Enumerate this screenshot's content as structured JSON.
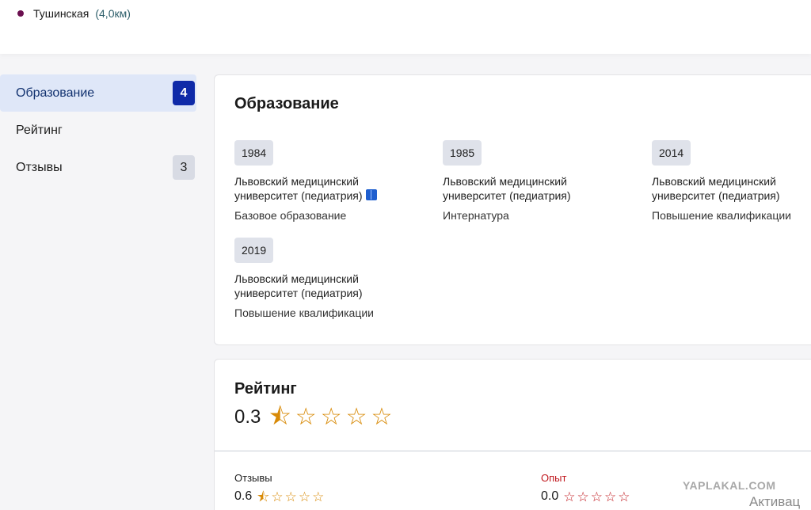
{
  "metro": {
    "station": "Тушинская",
    "distance": "(4,0км)"
  },
  "sidebar": {
    "items": [
      {
        "label": "Образование",
        "badge": "4"
      },
      {
        "label": "Рейтинг",
        "badge": ""
      },
      {
        "label": "Отзывы",
        "badge": "3"
      }
    ]
  },
  "education": {
    "title": "Образование",
    "items": [
      {
        "year": "1984",
        "institution": "Львовский медицинский университет (педиатрия)",
        "type": "Базовое образование"
      },
      {
        "year": "1985",
        "institution": "Львовский медицинский университет (педиатрия)",
        "type": "Интернатура"
      },
      {
        "year": "2014",
        "institution": "Львовский медицинский университет (педиатрия)",
        "type": "Повышение квалификации"
      },
      {
        "year": "2019",
        "institution": "Львовский медицинский университет (педиатрия)",
        "type": "Повышение квалификации"
      }
    ]
  },
  "rating": {
    "title": "Рейтинг",
    "value": "0.3",
    "reviews": {
      "label": "Отзывы",
      "value": "0.6"
    },
    "experience": {
      "label": "Опыт",
      "value": "0.0"
    }
  },
  "overlay": {
    "watermark": "YAPLAKAL.COM",
    "activate": "Активац"
  },
  "colors": {
    "accent": "#0f2aa8",
    "star": "#d88a07",
    "red": "#c0171d"
  }
}
